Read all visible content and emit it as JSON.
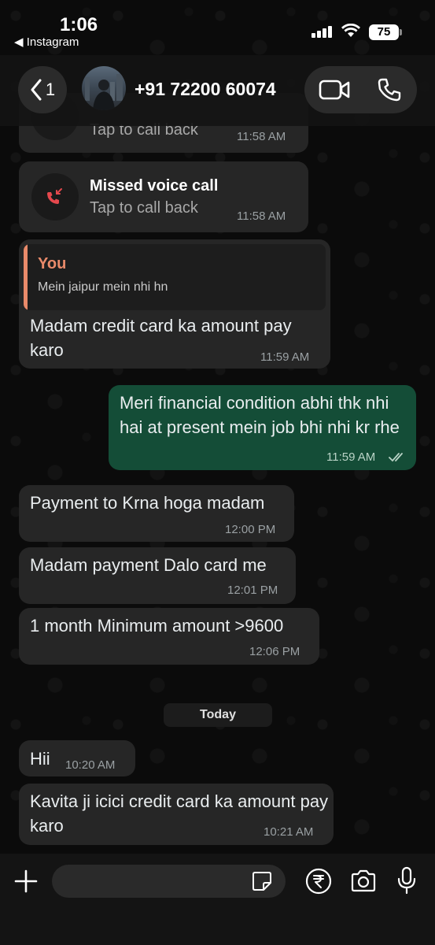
{
  "status_bar": {
    "time": "1:06",
    "back_app": "◀ Instagram",
    "battery": "75"
  },
  "header": {
    "back_count": "1",
    "contact_name": "+91 72200 60074"
  },
  "messages": {
    "call1": {
      "title": "",
      "subtitle": "Tap to call back",
      "time": "11:58 AM"
    },
    "call2": {
      "title": "Missed voice call",
      "subtitle": "Tap to call back",
      "time": "11:58 AM"
    },
    "reply1": {
      "quote_author": "You",
      "quote_text": "Mein jaipur mein nhi hn",
      "text": "Madam credit card ka amount pay karo",
      "time": "11:59 AM"
    },
    "out1": {
      "text": "Meri financial condition abhi thk nhi hai at present mein job bhi nhi kr rhe",
      "time": "11:59 AM"
    },
    "in1": {
      "text": "Payment to Krna hoga madam",
      "time": "12:00 PM"
    },
    "in2": {
      "text": "Madam payment Dalo card me",
      "time": "12:01 PM"
    },
    "in3": {
      "text": "1 month Minimum amount >9600",
      "time": "12:06 PM"
    },
    "day_label": "Today",
    "in4": {
      "text": "Hii",
      "time": "10:20 AM"
    },
    "in5": {
      "text": "Kavita ji icici credit card ka amount pay karo",
      "time": "10:21 AM"
    }
  },
  "composer": {
    "placeholder": ""
  },
  "colors": {
    "incoming_bubble": "#262626",
    "outgoing_bubble": "#144d37",
    "missed_call_red": "#e5484d",
    "quote_accent": "#e98a6a"
  },
  "icons": [
    "back-chevron-icon",
    "video-call-icon",
    "phone-call-icon",
    "missed-call-icon",
    "read-receipt-icon",
    "plus-icon",
    "sticker-icon",
    "rupee-icon",
    "camera-icon",
    "microphone-icon"
  ]
}
